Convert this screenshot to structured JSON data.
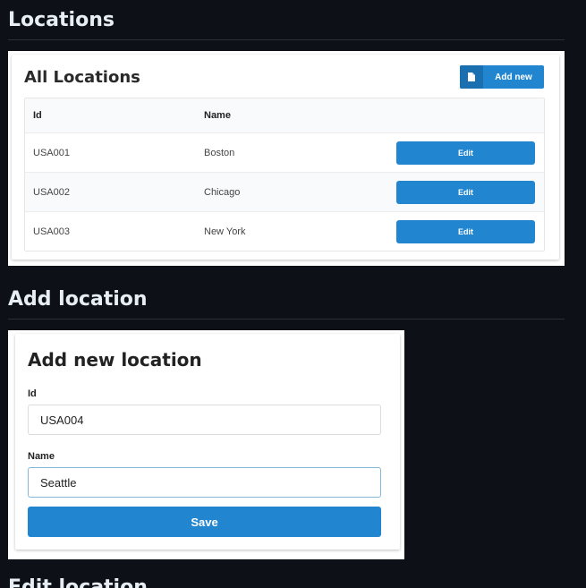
{
  "sections": {
    "locations_heading": "Locations",
    "add_heading": "Add location",
    "edit_heading": "Edit location"
  },
  "all_locations": {
    "title": "All Locations",
    "add_new_label": "Add new",
    "add_new_icon": "file-icon",
    "columns": [
      "Id",
      "Name",
      ""
    ],
    "rows": [
      {
        "id": "USA001",
        "name": "Boston",
        "action": "Edit"
      },
      {
        "id": "USA002",
        "name": "Chicago",
        "action": "Edit"
      },
      {
        "id": "USA003",
        "name": "New York",
        "action": "Edit"
      }
    ]
  },
  "add_form": {
    "title": "Add new location",
    "id_label": "Id",
    "id_value": "USA004",
    "name_label": "Name",
    "name_value": "Seattle",
    "save_label": "Save"
  },
  "colors": {
    "page_bg": "#0d1117",
    "primary": "#2185d0",
    "heading_text": "#e6edf3"
  }
}
